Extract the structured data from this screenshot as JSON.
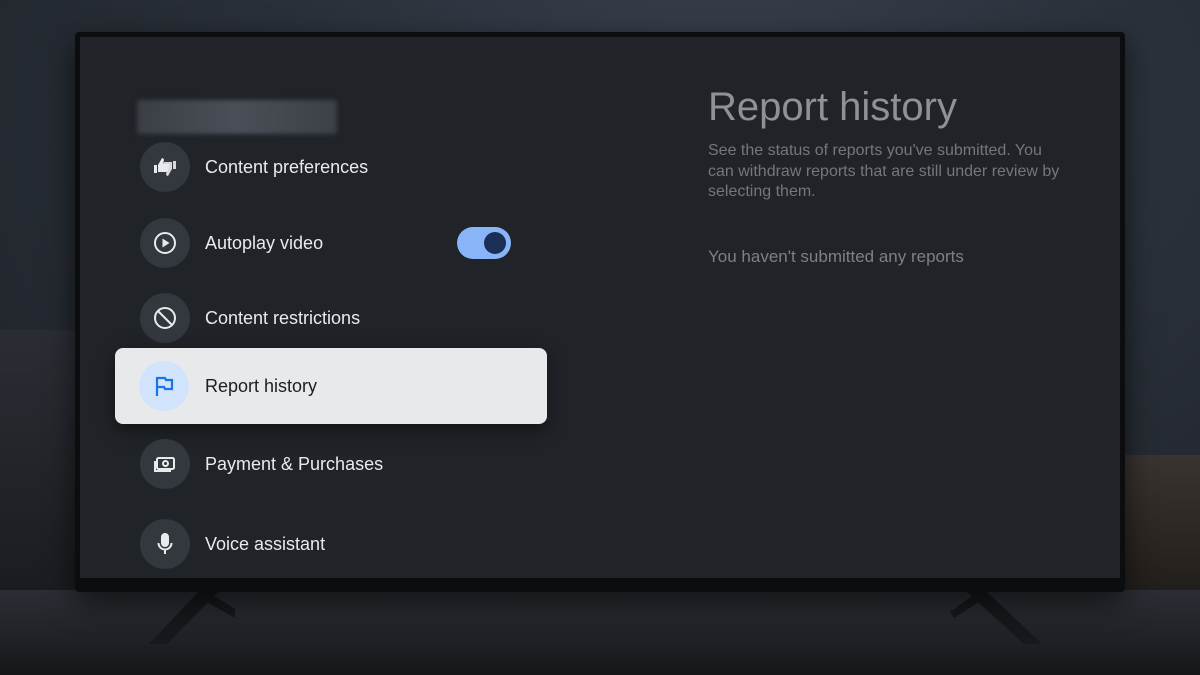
{
  "settings_menu": {
    "items": [
      {
        "label": "Content preferences",
        "icon": "thumbs-up-down-icon"
      },
      {
        "label": "Autoplay video",
        "icon": "play-circle-icon",
        "toggle_on": true
      },
      {
        "label": "Content restrictions",
        "icon": "block-icon"
      },
      {
        "label": "Report history",
        "icon": "flag-icon",
        "selected": true
      },
      {
        "label": "Payment & Purchases",
        "icon": "payment-icon"
      },
      {
        "label": "Voice assistant",
        "icon": "microphone-icon"
      }
    ]
  },
  "detail": {
    "title": "Report history",
    "description": "See the status of reports you've submitted. You can withdraw reports that are still under review by selecting them.",
    "empty_message": "You haven't submitted any reports"
  },
  "colors": {
    "screen_bg": "#202328",
    "selected_bg": "#e8e9eb",
    "accent": "#8ab4f8",
    "flag_icon": "#1a73e8"
  }
}
